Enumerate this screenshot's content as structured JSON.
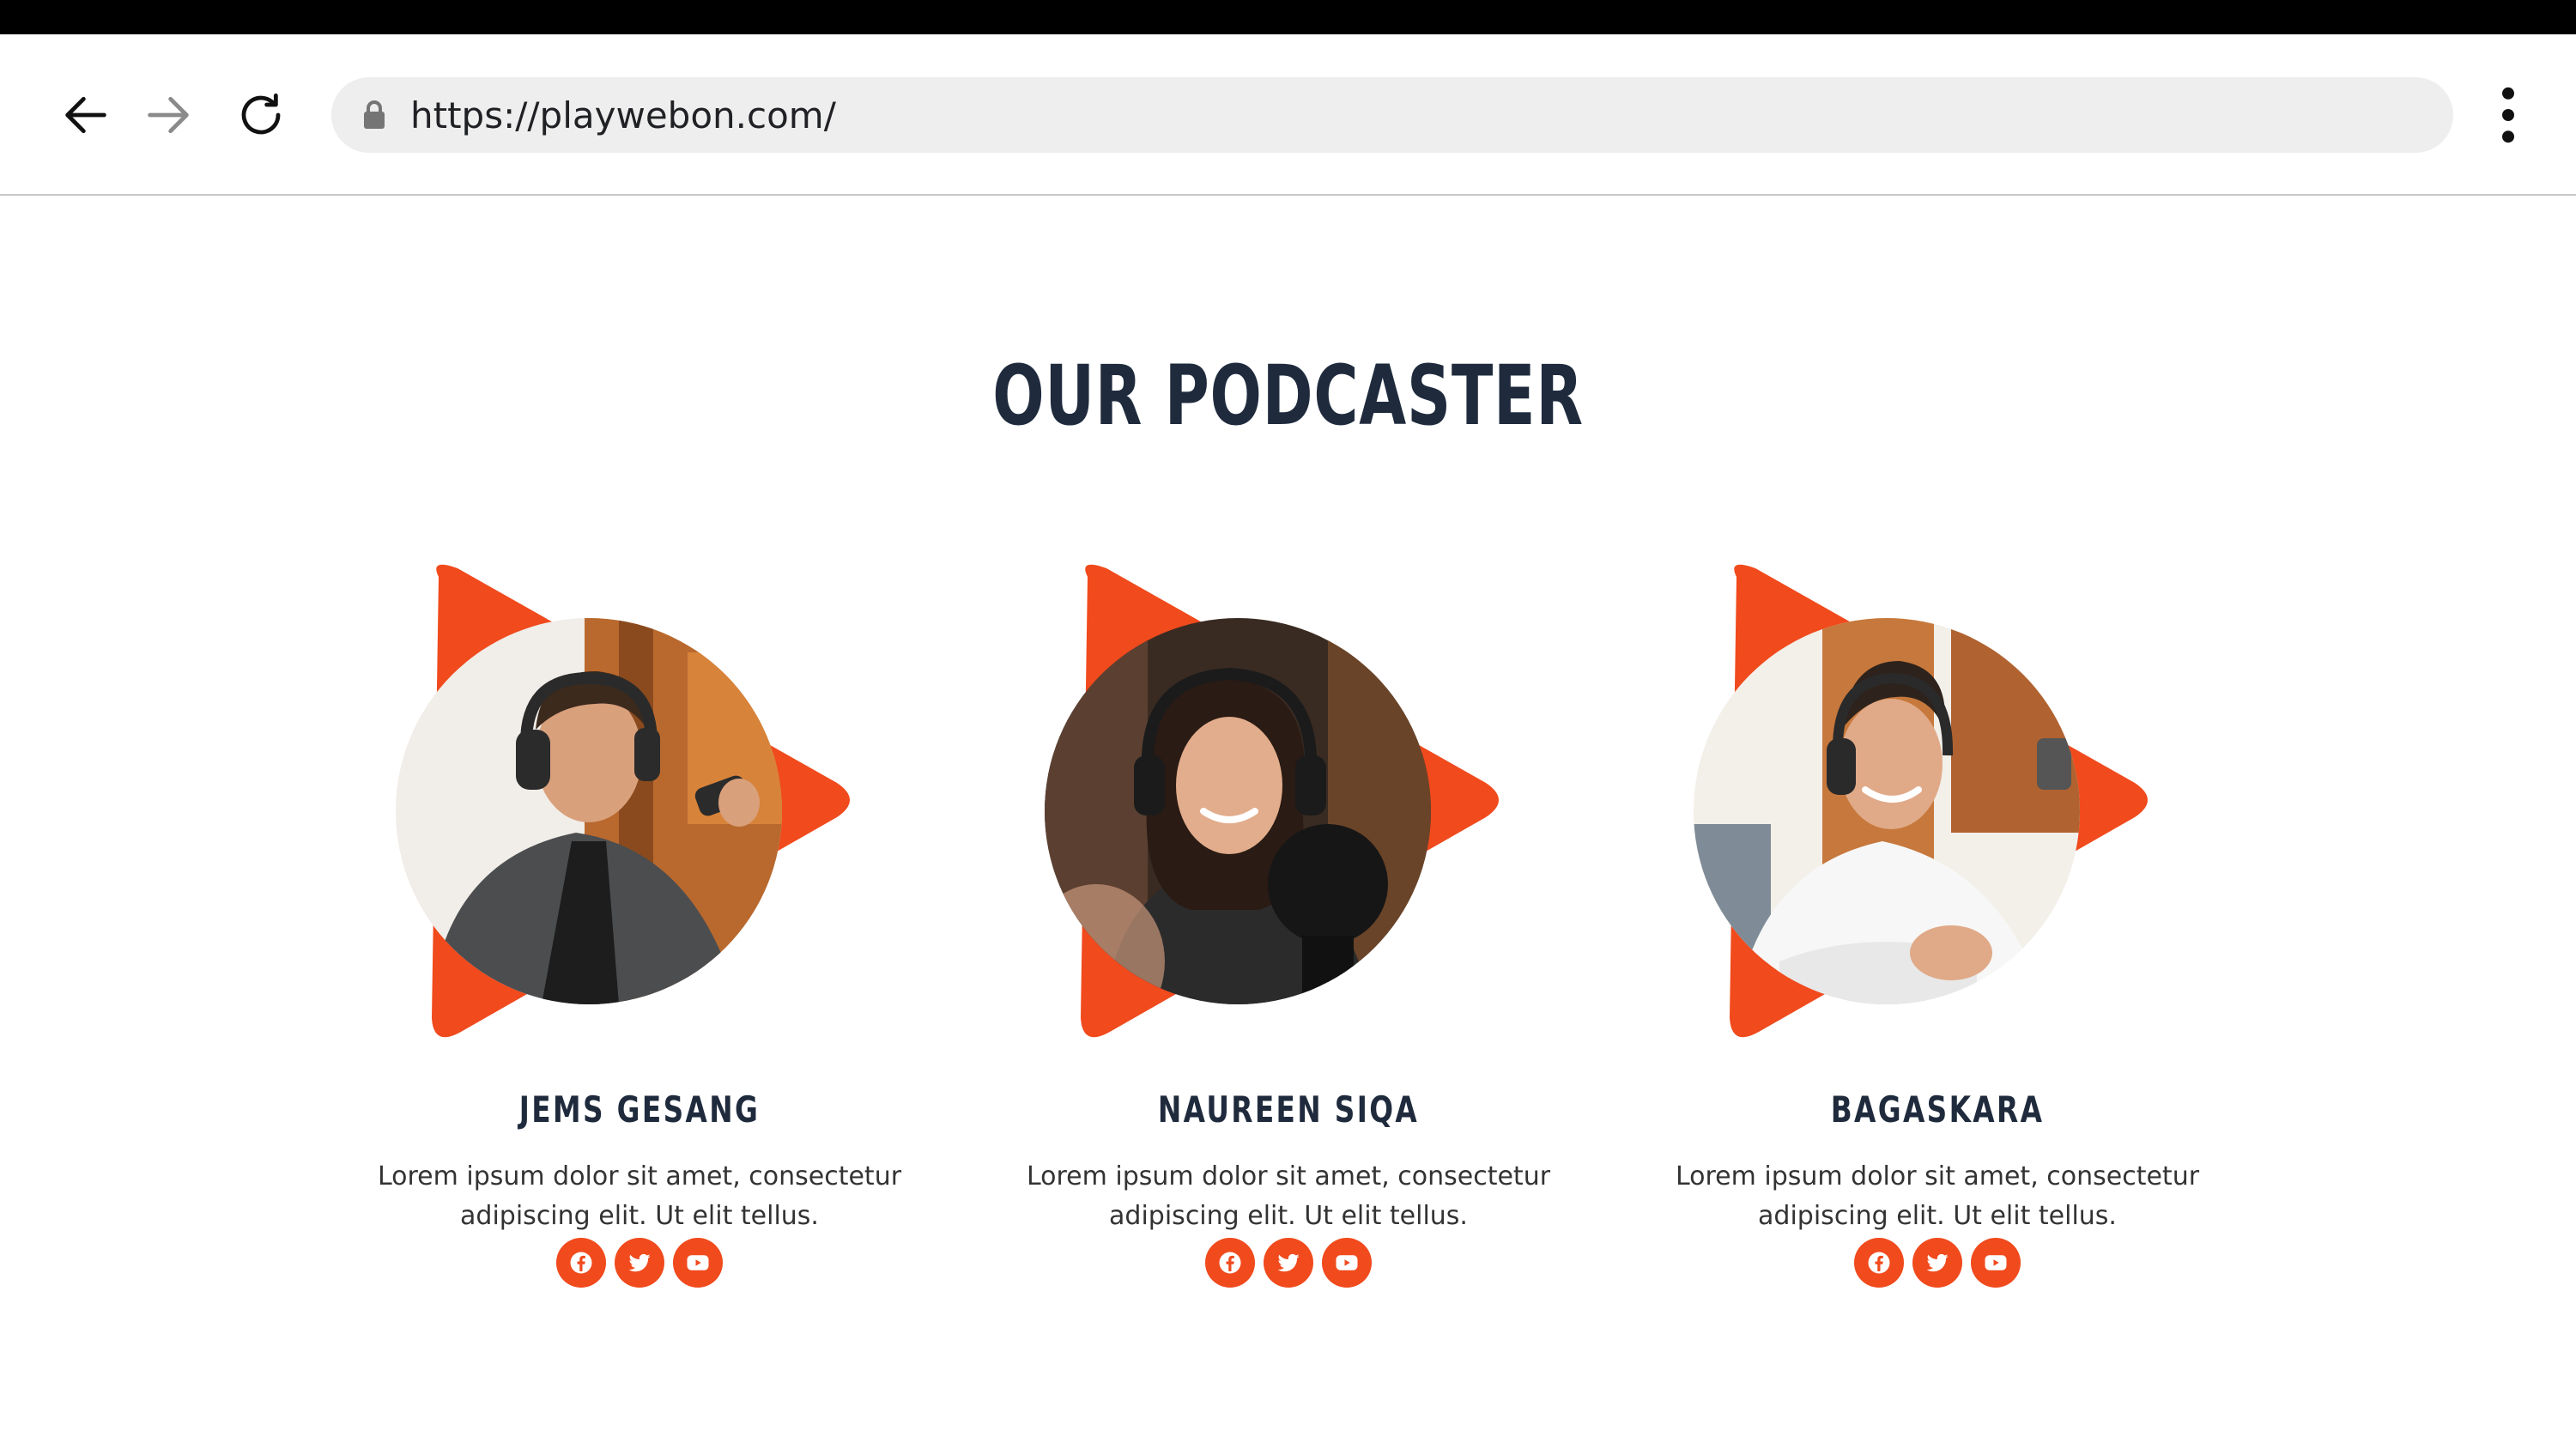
{
  "browser": {
    "url": "https://playwebon.com/",
    "back_icon": "arrow-left-icon",
    "forward_icon": "arrow-right-icon",
    "reload_icon": "reload-icon",
    "menu_icon": "more-vertical-icon"
  },
  "section": {
    "title": "OUR PODCASTER"
  },
  "colors": {
    "accent": "#f04a1d",
    "heading": "#1f2b3d",
    "body_text": "#333333"
  },
  "podcasters": [
    {
      "name": "JEMS GESANG",
      "bio": "Lorem ipsum dolor sit amet, consectetur adipiscing elit. Ut elit tellus.",
      "socials": [
        "facebook-icon",
        "twitter-icon",
        "youtube-icon"
      ]
    },
    {
      "name": "NAUREEN SIQA",
      "bio": "Lorem ipsum dolor sit amet, consectetur adipiscing elit. Ut elit tellus.",
      "socials": [
        "facebook-icon",
        "twitter-icon",
        "youtube-icon"
      ]
    },
    {
      "name": "BAGASKARA",
      "bio": "Lorem ipsum dolor sit amet, consectetur adipiscing elit. Ut elit tellus.",
      "socials": [
        "facebook-icon",
        "twitter-icon",
        "youtube-icon"
      ]
    }
  ]
}
